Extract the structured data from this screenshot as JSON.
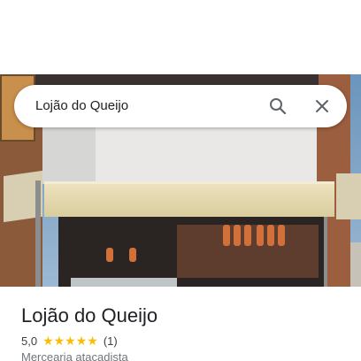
{
  "search": {
    "query": "Lojão do Queijo"
  },
  "place": {
    "name": "Lojão do Queijo",
    "rating": "5,0",
    "stars": "★★★★★",
    "review_count": "(1)",
    "category": "Mercearia atacadista"
  },
  "colors": {
    "star": "#fbbc04",
    "title_text": "#202124",
    "secondary_text": "#70757a"
  },
  "icons": {
    "search": "search-icon",
    "close": "close-icon"
  }
}
